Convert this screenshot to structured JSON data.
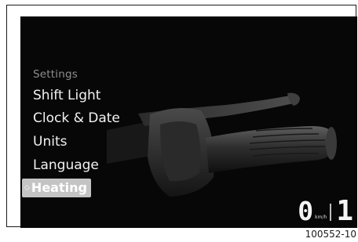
{
  "menu": {
    "header": "Settings",
    "items": [
      {
        "label": "Shift Light",
        "selected": false
      },
      {
        "label": "Clock & Date",
        "selected": false
      },
      {
        "label": "Units",
        "selected": false
      },
      {
        "label": "Language",
        "selected": false
      },
      {
        "label": "Heating",
        "selected": true
      }
    ]
  },
  "hud": {
    "speed": "0",
    "speed_unit": "km/h",
    "gear": "1"
  },
  "figure_id": "100552-10",
  "illustration": {
    "subject": "handlebar-grip-with-heating",
    "icon": "heated-grip-illustration"
  },
  "colors": {
    "screen_background": "#070707",
    "menu_text": "#f2f2f2",
    "menu_header": "#8e8e8e",
    "selection_background": "#c4c4c4"
  }
}
